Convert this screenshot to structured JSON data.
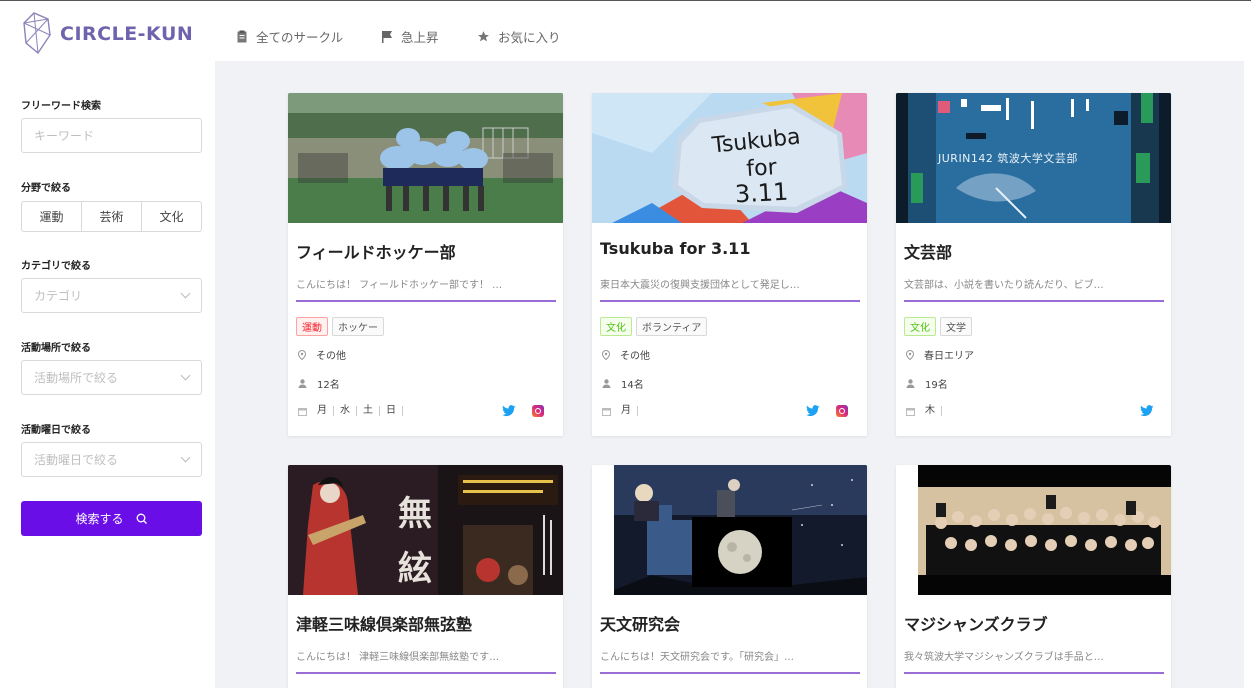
{
  "app": {
    "name": "CIRCLE-KUN",
    "accent": "#6a0ee8",
    "logo_color": "#6e64ad"
  },
  "nav": [
    {
      "label": "全てのサークル",
      "icon": "clipboard-icon"
    },
    {
      "label": "急上昇",
      "icon": "flag-icon"
    },
    {
      "label": "お気に入り",
      "icon": "star-icon"
    }
  ],
  "sidebar": {
    "freeword": {
      "label": "フリーワード検索",
      "placeholder": "キーワード"
    },
    "field": {
      "label": "分野で絞る",
      "options": [
        "運動",
        "芸術",
        "文化"
      ]
    },
    "category": {
      "label": "カテゴリで絞る",
      "placeholder": "カテゴリ"
    },
    "place": {
      "label": "活動場所で絞る",
      "placeholder": "活動場所で絞る"
    },
    "weekday": {
      "label": "活動曜日で絞る",
      "placeholder": "活動曜日で絞る"
    },
    "search_button": "検索する"
  },
  "cards": [
    {
      "title": "フィールドホッケー部",
      "desc": "こんにちは！ フィールドホッケー部です！ …",
      "tags": [
        {
          "label": "運動",
          "style": "red"
        },
        {
          "label": "ホッケー",
          "style": "gray"
        }
      ],
      "place": "その他",
      "members": "12名",
      "days": [
        "月",
        "水",
        "土",
        "日"
      ],
      "social": [
        "twitter-icon",
        "instagram-icon"
      ]
    },
    {
      "title": "Tsukuba for 3.11",
      "desc": "東日本大震災の復興支援団体として発足し…",
      "tags": [
        {
          "label": "文化",
          "style": "green"
        },
        {
          "label": "ボランティア",
          "style": "gray"
        }
      ],
      "place": "その他",
      "members": "14名",
      "days": [
        "月"
      ],
      "social": [
        "twitter-icon",
        "instagram-icon"
      ],
      "image_text": [
        "Tsukuba",
        "for",
        "3.11"
      ]
    },
    {
      "title": "文芸部",
      "desc": "文芸部は、小説を書いたり読んだり、ビブ…",
      "tags": [
        {
          "label": "文化",
          "style": "green"
        },
        {
          "label": "文学",
          "style": "gray"
        }
      ],
      "place": "春日エリア",
      "members": "19名",
      "days": [
        "木"
      ],
      "social": [
        "twitter-icon"
      ],
      "image_text": [
        "JURIN142 筑波大学文芸部"
      ]
    },
    {
      "title": "津軽三味線倶楽部無弦塾",
      "desc": "こんにちは！ 津軽三味線倶楽部無絃塾です…"
    },
    {
      "title": "天文研究会",
      "desc": "こんにちは！天文研究会です。「研究会」…"
    },
    {
      "title": "マジシャンズクラブ",
      "desc": "我々筑波大学マジシャンズクラブは手品と…"
    }
  ]
}
